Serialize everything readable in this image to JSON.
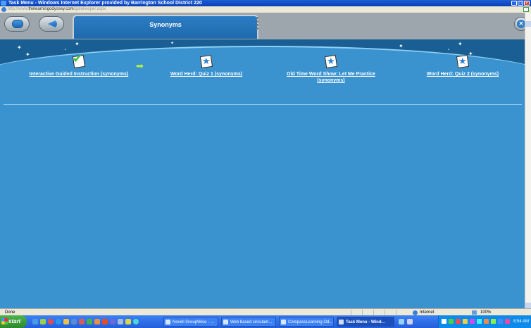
{
  "window": {
    "title": "Task Menu - Windows Internet Explorer provided by Barrington School District 220",
    "url_prefix": "http://www.",
    "url_domain": "thelearningodyssey.com",
    "url_path": "/gatekeeper.aspx"
  },
  "app": {
    "title": "Synonyms"
  },
  "activities": [
    {
      "label": "Interactive Guided Instruction (synonyms)",
      "icon": "completed-check-icon"
    },
    {
      "label": "Word Herd: Quiz 1 (synonyms)",
      "icon": "quiz-paper-icon"
    },
    {
      "label": "Old Time Word Show: Let Me Practice (synonyms)",
      "icon": "quiz-paper-icon"
    },
    {
      "label": "Word Herd: Quiz 2 (synonyms)",
      "icon": "quiz-paper-icon"
    }
  ],
  "status": {
    "text": "Done",
    "zone": "Internet",
    "zoom": "100%"
  },
  "taskbar": {
    "start": "start",
    "tasks": [
      {
        "label": "Novell GroupWise - ..."
      },
      {
        "label": "Web based circulam..."
      },
      {
        "label": "CompassLearning Od..."
      },
      {
        "label": "Task Menu - Wind..."
      }
    ],
    "clock": "8:54 AM"
  },
  "colors": {
    "accent": "#3a93cf",
    "header": "#1a5f93",
    "check": "#3dc23d",
    "arrow": "#b7ec4b"
  }
}
